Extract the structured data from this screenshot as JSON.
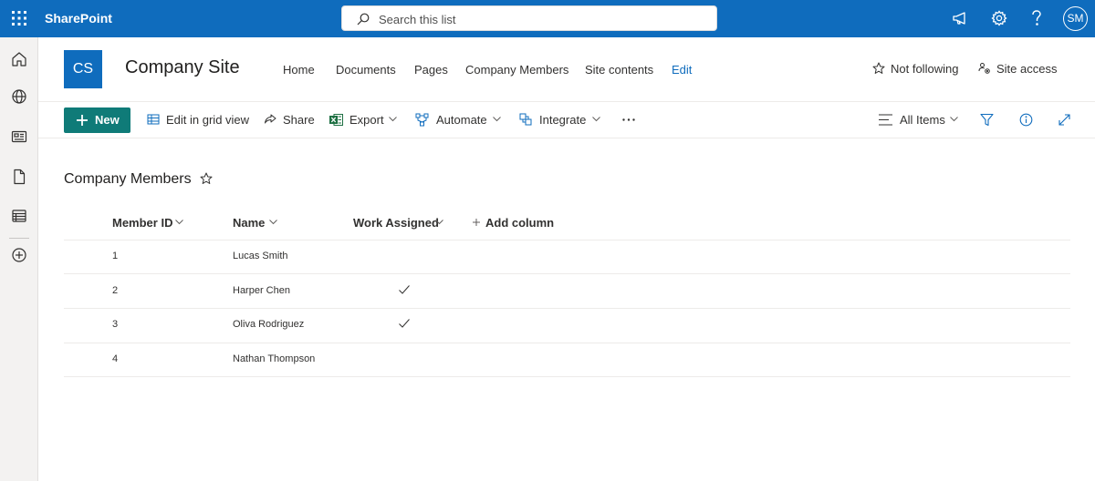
{
  "topbar": {
    "app_name": "SharePoint",
    "search_placeholder": "Search this list",
    "avatar_initials": "SM",
    "brand_color": "#0f6cbd"
  },
  "site": {
    "logo_initials": "CS",
    "title": "Company Site",
    "nav": [
      "Home",
      "Documents",
      "Pages",
      "Company Members",
      "Site contents",
      "Edit"
    ],
    "follow_label": "Not following",
    "access_label": "Site access"
  },
  "commands": {
    "new_label": "New",
    "edit_grid_label": "Edit in grid view",
    "share_label": "Share",
    "export_label": "Export",
    "automate_label": "Automate",
    "integrate_label": "Integrate",
    "view_label": "All Items",
    "accent_color": "#0f7b78"
  },
  "list": {
    "title": "Company Members",
    "columns": [
      "Member ID",
      "Name",
      "Work Assigned"
    ],
    "add_column_label": "Add column",
    "rows": [
      {
        "id": "1",
        "name": "Lucas Smith",
        "work_assigned": false
      },
      {
        "id": "2",
        "name": "Harper Chen",
        "work_assigned": true
      },
      {
        "id": "3",
        "name": "Oliva Rodriguez",
        "work_assigned": true
      },
      {
        "id": "4",
        "name": "Nathan Thompson",
        "work_assigned": false
      }
    ]
  }
}
